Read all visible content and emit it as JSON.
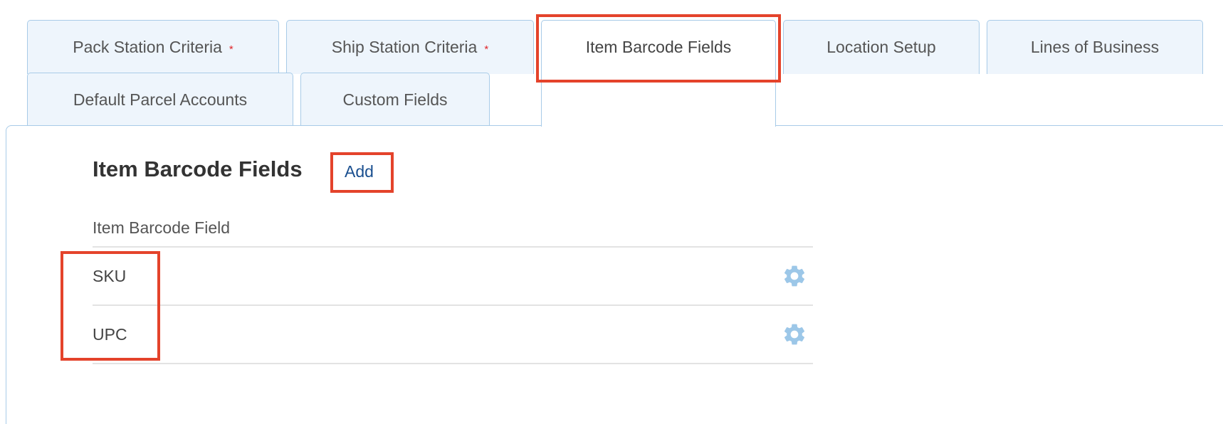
{
  "tabs": [
    {
      "label": "Pack Station Criteria",
      "required_mark": "*"
    },
    {
      "label": "Ship Station Criteria",
      "required_mark": "*"
    },
    {
      "label": "Item Barcode Fields"
    },
    {
      "label": "Location Setup"
    },
    {
      "label": "Lines of Business"
    },
    {
      "label": "Default Parcel Accounts"
    },
    {
      "label": "Custom Fields"
    }
  ],
  "active_tab": "Item Barcode Fields",
  "section": {
    "title": "Item Barcode Fields",
    "add_label": "Add",
    "column_header": "Item Barcode Field",
    "rows": [
      {
        "label": "SKU",
        "action_icon": "gear-icon"
      },
      {
        "label": "UPC",
        "action_icon": "gear-icon"
      }
    ]
  },
  "colors": {
    "tab_background": "#eef5fc",
    "tab_border": "#a8cbe8",
    "required_marker": "#e0262a",
    "link": "#1a4f8f",
    "gear": "#9cc7e8",
    "annotation_box": "#e4432b"
  }
}
